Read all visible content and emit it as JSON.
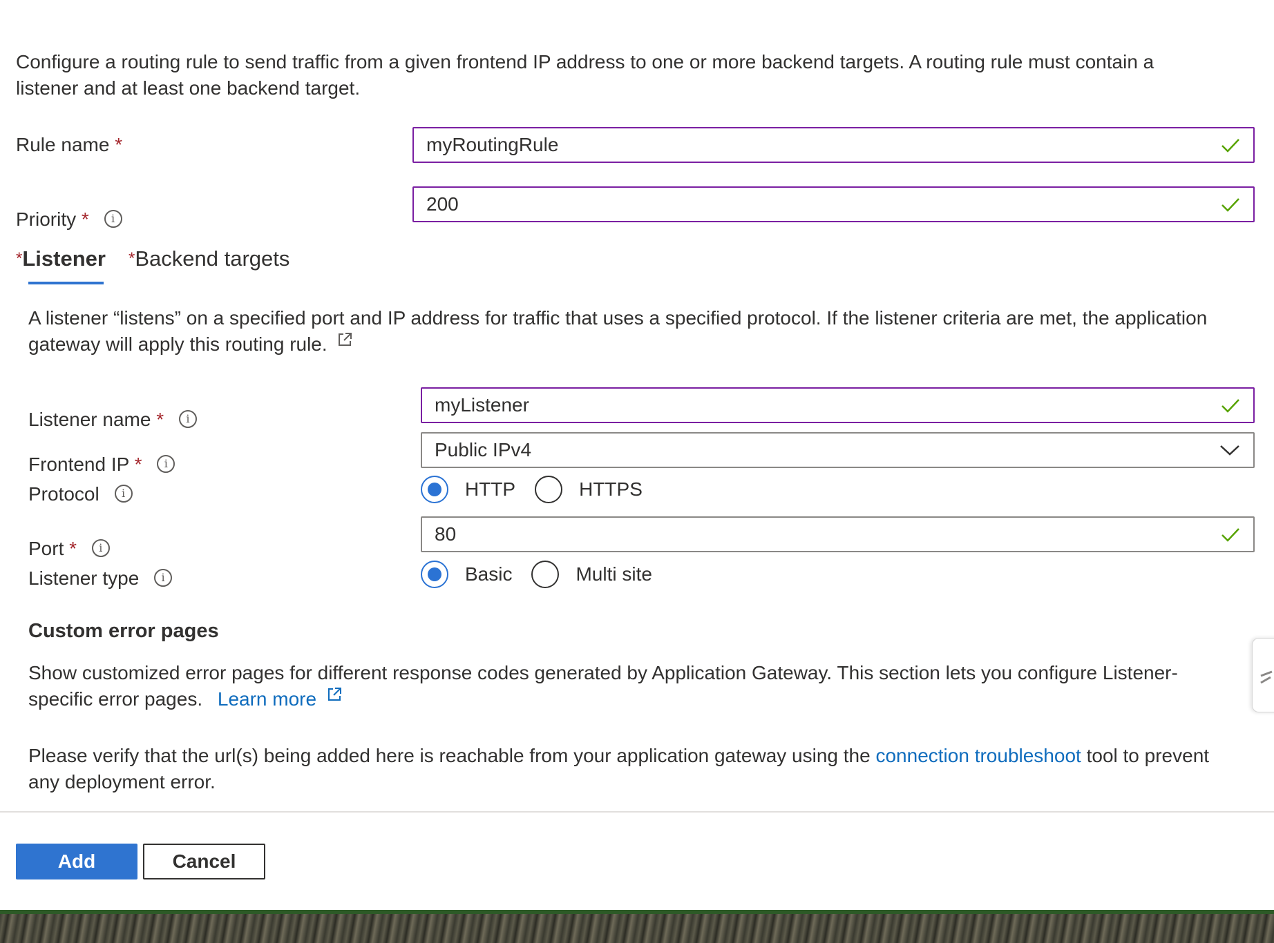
{
  "intro": {
    "line1": "Configure a routing rule to send traffic from a given frontend IP address to one or more backend targets. A routing rule must contain a",
    "line2": "listener and at least one backend target."
  },
  "rule_name": {
    "label": "Rule name",
    "required": "*",
    "value": "myRoutingRule"
  },
  "priority": {
    "label": "Priority",
    "required": "*",
    "value": "200"
  },
  "tabs": [
    {
      "required": "*",
      "label": "Listener",
      "active": true
    },
    {
      "required": "*",
      "label": "Backend targets",
      "active": false
    }
  ],
  "listener_desc": {
    "line1": "A listener “listens” on a specified port and IP address for traffic that uses a specified protocol. If the listener criteria are met, the application",
    "line2": "gateway will apply this routing rule."
  },
  "listener_name": {
    "label": "Listener name",
    "required": "*",
    "value": "myListener"
  },
  "frontend_ip": {
    "label": "Frontend IP",
    "required": "*",
    "value": "Public IPv4"
  },
  "protocol": {
    "label": "Protocol",
    "options": [
      "HTTP",
      "HTTPS"
    ],
    "selected": "HTTP"
  },
  "port": {
    "label": "Port",
    "required": "*",
    "value": "80"
  },
  "listener_type": {
    "label": "Listener type",
    "options": [
      "Basic",
      "Multi site"
    ],
    "selected": "Basic"
  },
  "custom_error": {
    "heading": "Custom error pages",
    "desc_line1": "Show customized error pages for different response codes generated by Application Gateway. This section lets you configure Listener-",
    "desc_line2": "specific error pages.",
    "learn_more": "Learn more",
    "verify_pre": "Please verify that the url(s) being added here is reachable from your application gateway using the",
    "verify_link": "connection troubleshoot",
    "verify_post": "tool to prevent",
    "verify_line2": "any deployment error."
  },
  "actions": {
    "add": "Add",
    "cancel": "Cancel"
  },
  "colors": {
    "accent": "#2f74d0",
    "valid": "#57a300",
    "field_active": "#7a1fa2",
    "required": "#a4262c",
    "link": "#0f6cbd"
  }
}
